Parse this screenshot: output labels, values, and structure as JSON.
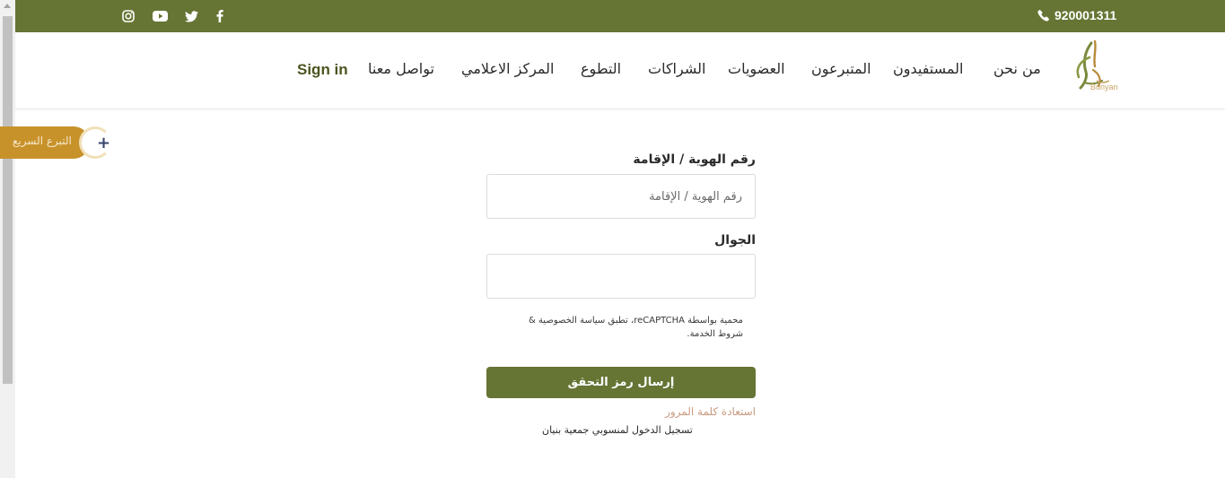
{
  "topbar": {
    "phone": "920001311",
    "social_icons": [
      "facebook-icon",
      "twitter-icon",
      "youtube-icon",
      "instagram-icon"
    ],
    "background": "#667534"
  },
  "header": {
    "logo_text": "Bunyan",
    "nav": [
      {
        "label": "من نحن"
      },
      {
        "label": "المستفيدون"
      },
      {
        "label": "المتبرعون"
      },
      {
        "label": "العضويات"
      },
      {
        "label": "الشراكات"
      },
      {
        "label": "التطوع"
      },
      {
        "label": "المركز الاعلامي"
      },
      {
        "label": "تواصل معنا"
      },
      {
        "label": "Sign in"
      }
    ]
  },
  "quick_donate": {
    "label": "التبرع السريع",
    "plus": "+",
    "color": "#c8922a"
  },
  "form": {
    "id_label": "رقم الهوية / الإقامة",
    "id_placeholder": "رقم الهوية / الإقامة",
    "id_value": "",
    "mobile_label": "الجوال",
    "mobile_value": "",
    "recaptcha_text": "محمية بواسطة reCAPTCHA، تطبق سياسة الخصوصية & شروط الخدمة.",
    "submit_label": "إرسال رمز التحقق",
    "forgot_password": "استعادة كلمة المرور",
    "staff_login": "تسجيل الدخول لمنسوبي جمعية بنيان"
  },
  "colors": {
    "accent": "#667534",
    "gold": "#c8922a",
    "link": "#c89a80"
  }
}
